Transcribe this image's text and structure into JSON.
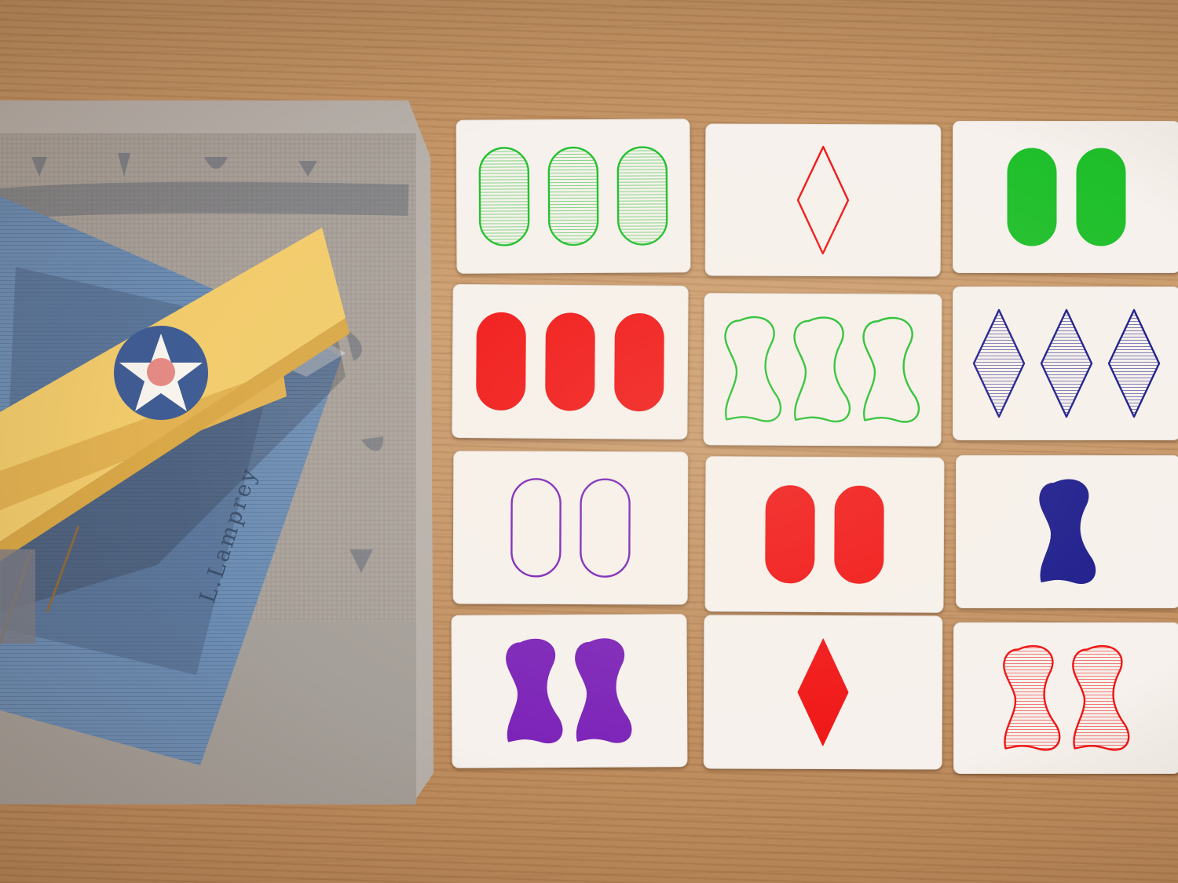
{
  "background": {
    "table_color": "#c4946a"
  },
  "books": {
    "bottom_book": {
      "color": "#a9a29b"
    },
    "top_book": {
      "color": "#6f8db0",
      "spine_text": "L.Lamprey"
    }
  },
  "plane": {
    "wing_color": "#f2cc6c",
    "roundel": {
      "outer": "#3f5c94",
      "star": "#f7f4ee",
      "center": "#e58a84"
    }
  },
  "cards": [
    {
      "number": 3,
      "shape": "oval",
      "fill": "striped",
      "color": "green"
    },
    {
      "number": 1,
      "shape": "diamond",
      "fill": "open",
      "color": "red"
    },
    {
      "number": 2,
      "shape": "oval",
      "fill": "solid",
      "color": "green"
    },
    {
      "number": 3,
      "shape": "oval",
      "fill": "solid",
      "color": "red"
    },
    {
      "number": 3,
      "shape": "squiggle",
      "fill": "open",
      "color": "green"
    },
    {
      "number": 3,
      "shape": "diamond",
      "fill": "striped",
      "color": "navy"
    },
    {
      "number": 2,
      "shape": "oval",
      "fill": "open",
      "color": "purple"
    },
    {
      "number": 2,
      "shape": "oval",
      "fill": "solid",
      "color": "red"
    },
    {
      "number": 1,
      "shape": "squiggle",
      "fill": "solid",
      "color": "navy"
    },
    {
      "number": 2,
      "shape": "squiggle",
      "fill": "solid",
      "color": "purple"
    },
    {
      "number": 1,
      "shape": "diamond",
      "fill": "solid",
      "color": "red"
    },
    {
      "number": 2,
      "shape": "squiggle",
      "fill": "striped",
      "color": "red"
    }
  ],
  "palette": {
    "green": "#1fbf2b",
    "red": "#f01414",
    "purple": "#7b22b8",
    "navy": "#1a1a8c"
  }
}
